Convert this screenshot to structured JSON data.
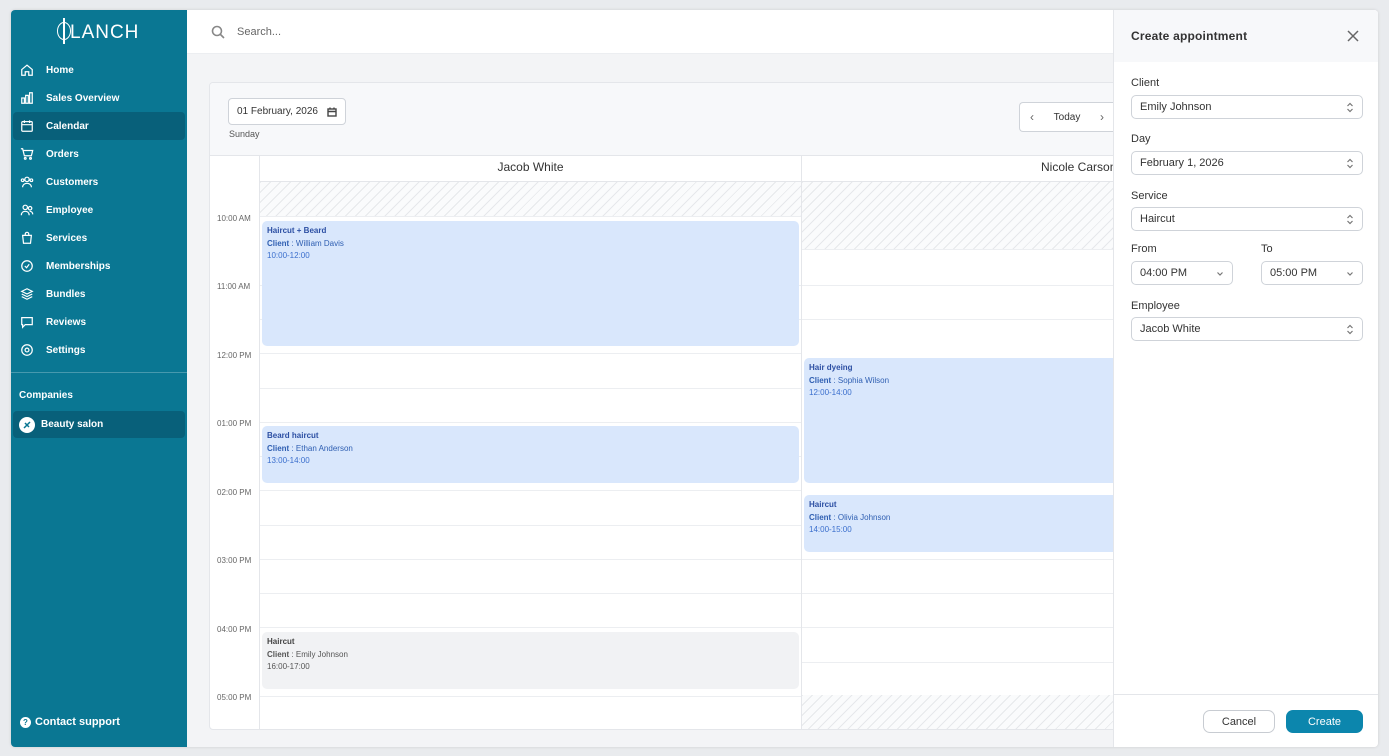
{
  "brand": {
    "logo_text": "LANCH"
  },
  "sidebar": {
    "items": [
      {
        "label": "Home",
        "icon": "home-icon"
      },
      {
        "label": "Sales Overview",
        "icon": "bar-chart-icon"
      },
      {
        "label": "Calendar",
        "icon": "calendar-icon",
        "active": true
      },
      {
        "label": "Orders",
        "icon": "cart-icon"
      },
      {
        "label": "Customers",
        "icon": "users-icon"
      },
      {
        "label": "Employee",
        "icon": "employee-icon"
      },
      {
        "label": "Services",
        "icon": "bag-icon"
      },
      {
        "label": "Memberships",
        "icon": "check-circle-icon"
      },
      {
        "label": "Bundles",
        "icon": "layers-icon"
      },
      {
        "label": "Reviews",
        "icon": "chat-icon"
      },
      {
        "label": "Settings",
        "icon": "settings-icon"
      }
    ],
    "companies_title": "Companies",
    "company": "Beauty salon",
    "support": "Contact support"
  },
  "search": {
    "placeholder": "Search..."
  },
  "calendar": {
    "date": "01 February, 2026",
    "weekday": "Sunday",
    "today_label": "Today",
    "prev_icon": "chevron-left-icon",
    "next_icon": "chevron-right-icon",
    "times": [
      "10:00 AM",
      "11:00 AM",
      "12:00 PM",
      "01:00 PM",
      "02:00 PM",
      "03:00 PM",
      "04:00 PM",
      "05:00 PM"
    ],
    "columns": [
      {
        "name": "Jacob White",
        "events": [
          {
            "title": "Haircut + Beard",
            "client_key": "Client",
            "client": "William Davis",
            "time": "10:00-12:00",
            "style": "blue"
          },
          {
            "title": "Beard haircut",
            "client_key": "Client",
            "client": "Ethan Anderson",
            "time": "13:00-14:00",
            "style": "blue"
          },
          {
            "title": "Haircut",
            "client_key": "Client",
            "client": "Emily Johnson",
            "time": "16:00-17:00",
            "style": "gray"
          }
        ]
      },
      {
        "name": "Nicole Carson",
        "events": [
          {
            "title": "Hair dyeing",
            "client_key": "Client",
            "client": "Sophia Wilson",
            "time": "12:00-14:00",
            "style": "blue"
          },
          {
            "title": "Haircut",
            "client_key": "Client",
            "client": "Olivia Johnson",
            "time": "14:00-15:00",
            "style": "blue"
          }
        ]
      }
    ]
  },
  "panel": {
    "title": "Create appointment",
    "client_label": "Client",
    "client_value": "Emily Johnson",
    "day_label": "Day",
    "day_value": "February 1, 2026",
    "service_label": "Service",
    "service_value": "Haircut",
    "from_label": "From",
    "from_value": "04:00 PM",
    "to_label": "To",
    "to_value": "05:00 PM",
    "employee_label": "Employee",
    "employee_value": "Jacob White",
    "cancel_label": "Cancel",
    "create_label": "Create"
  },
  "colors": {
    "sidebar": "#0a7793",
    "sidebar_active": "#08607a",
    "accent": "#0c86ad",
    "event_blue": "#d9e7fc",
    "event_gray": "#f1f2f4"
  }
}
